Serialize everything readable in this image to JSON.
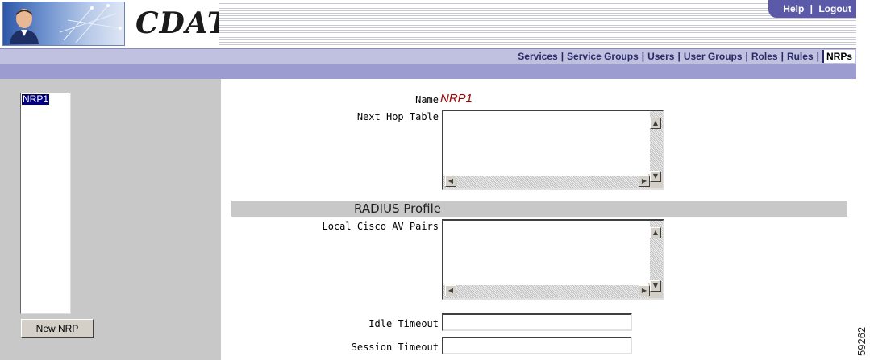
{
  "header": {
    "app_title": "CDAT",
    "help_label": "Help",
    "logout_label": "Logout",
    "separator": "|"
  },
  "nav": {
    "items": [
      {
        "label": "Services"
      },
      {
        "label": "Service Groups"
      },
      {
        "label": "Users"
      },
      {
        "label": "User Groups"
      },
      {
        "label": "Roles"
      },
      {
        "label": "Rules"
      },
      {
        "label": "NRPs"
      }
    ],
    "active": "NRPs"
  },
  "sidebar": {
    "list_items": [
      "NRP1"
    ],
    "selected": "NRP1",
    "new_button_label": "New NRP"
  },
  "form": {
    "name_label": "Name",
    "name_value": "NRP1",
    "next_hop_label": "Next Hop Table",
    "next_hop_value": "",
    "section_title": "RADIUS Profile",
    "av_pairs_label": "Local Cisco AV Pairs",
    "av_pairs_value": "",
    "idle_timeout_label": "Idle Timeout",
    "idle_timeout_value": "",
    "session_timeout_label": "Session Timeout",
    "session_timeout_value": ""
  },
  "figure_number": "59262",
  "colors": {
    "navbar": "#c0c0e0",
    "subbar": "#9c9cd0",
    "help_tab": "#5a5aa8",
    "name_value": "#a00000",
    "selection": "#000080"
  }
}
